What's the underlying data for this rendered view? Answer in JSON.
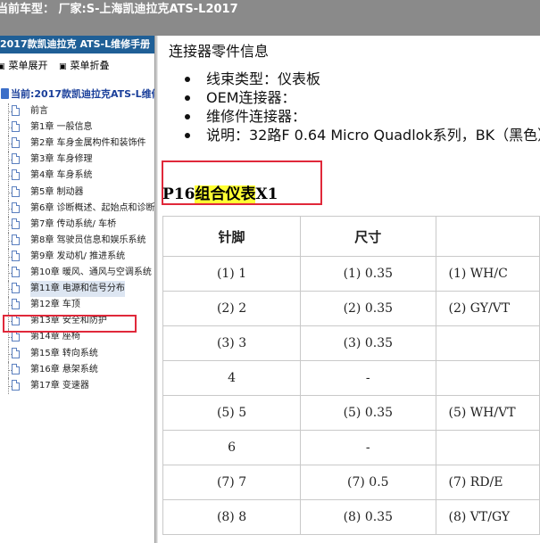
{
  "topbar": {
    "text": "当前车型： 厂家:S-上海凯迪拉克ATS-L2017"
  },
  "left": {
    "header": "2017款凯迪拉克 ATS-L维修手册",
    "expand_label": "菜单展开",
    "collapse_label": "菜单折叠",
    "root_label": "当前:2017款凯迪拉克ATS-L维修",
    "items": [
      {
        "label": "前言"
      },
      {
        "label": "第1章 一般信息"
      },
      {
        "label": "第2章 车身金属构件和装饰件"
      },
      {
        "label": "第3章 车身修理"
      },
      {
        "label": "第4章 车身系统"
      },
      {
        "label": "第5章 制动器"
      },
      {
        "label": "第6章 诊断概述、起始点和诊断"
      },
      {
        "label": "第7章 传动系统/ 车桥"
      },
      {
        "label": "第8章 驾驶员信息和娱乐系统"
      },
      {
        "label": "第9章 发动机/ 推进系统"
      },
      {
        "label": "第10章 暖风、通风与空调系统"
      },
      {
        "label": "第11章 电源和信号分布",
        "selected": true
      },
      {
        "label": "第12章 车顶"
      },
      {
        "label": "第13章 安全和防护"
      },
      {
        "label": "第14章 座椅"
      },
      {
        "label": "第15章 转向系统"
      },
      {
        "label": "第16章 悬架系统"
      },
      {
        "label": "第17章 变速器"
      }
    ]
  },
  "content": {
    "title": "连接器零件信息",
    "bullets": [
      "线束类型：仪表板",
      "OEM连接器：",
      "维修件连接器：",
      "说明：32路F 0.64 Micro Quadlok系列，BK（黑色）"
    ],
    "heading_prefix": "P16",
    "heading_highlight": "组合仪表",
    "heading_suffix": "X1",
    "table": {
      "headers": [
        "针脚",
        "尺寸",
        ""
      ],
      "rows": [
        [
          "(1) 1",
          "(1) 0.35",
          "(1) WH/C"
        ],
        [
          "(2) 2",
          "(2) 0.35",
          "(2) GY/VT"
        ],
        [
          "(3) 3",
          "(3) 0.35",
          ""
        ],
        [
          "4",
          "-",
          ""
        ],
        [
          "(5) 5",
          "(5) 0.35",
          "(5) WH/VT"
        ],
        [
          "6",
          "-",
          ""
        ],
        [
          "(7) 7",
          "(7) 0.5",
          "(7) RD/E"
        ],
        [
          "(8) 8",
          "(8) 0.35",
          "(8) VT/GY"
        ]
      ]
    }
  },
  "colors": {
    "header_blue": "#1f5f96",
    "highlight": "#ffff33",
    "annotation_red": "#e0283a"
  }
}
